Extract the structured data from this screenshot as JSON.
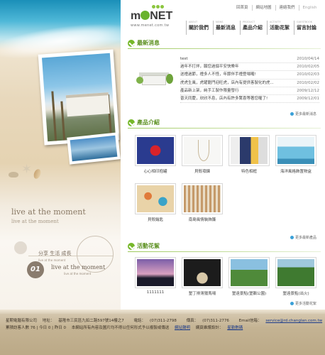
{
  "brand": {
    "name_prefix": "m",
    "name_suffix": "NET",
    "url": "www.menet.com.tw"
  },
  "top_links": [
    "回首頁",
    "網站地圖",
    "連絡我們",
    "English"
  ],
  "nav": [
    {
      "en": "About",
      "zh": "關於我們"
    },
    {
      "en": "News",
      "zh": "最新消息"
    },
    {
      "en": "Product",
      "zh": "產品介紹"
    },
    {
      "en": "Activity",
      "zh": "活動花絮"
    },
    {
      "en": "Guestbook",
      "zh": "留言討論"
    }
  ],
  "left_panel": {
    "slogan": "live at the moment",
    "slogan_small": "live at the moment",
    "tagline": "分享  生活  成長",
    "tagline_sub": "live at the moment",
    "number": "01",
    "slogan2": "live at the moment",
    "slogan2_sub": "live at the moment"
  },
  "news": {
    "title": "最新消息",
    "more": "更多最新消息",
    "items": [
      {
        "title": "test",
        "date": "2010/04/14"
      },
      {
        "title": "過年不打烊，願您過個平安快樂年",
        "date": "2010/02/05"
      },
      {
        "title": "送禮過節，禮多人不怪，年節伴手禮登場囉!",
        "date": "2010/02/03"
      },
      {
        "title": "虎虎生風，虎躍龍門迎旺虎，店內有提供客製化的虎...",
        "date": "2010/02/02"
      },
      {
        "title": "產品新上架，純手工製作限量發行",
        "date": "2009/12/12"
      },
      {
        "title": "普天同慶，欣欣不息，店內有許多驚喜等著您喔了!",
        "date": "2009/12/01"
      }
    ]
  },
  "products": {
    "title": "產品介紹",
    "more": "更多最新產品",
    "items": [
      {
        "name": "心心相印抱罐"
      },
      {
        "name": "貝殼項鍊"
      },
      {
        "name": "特色相框"
      },
      {
        "name": "海洋風格飾置物盒"
      },
      {
        "name": "貝殼鑰匙"
      },
      {
        "name": "南島風情裝飾簾"
      }
    ]
  },
  "activities": {
    "title": "活動花絮",
    "more": "更多活動花絮",
    "items": [
      {
        "name": "1111111"
      },
      {
        "name": "墾丁排灣獵馬場"
      },
      {
        "name": "墾遠景點(墾鵝公園)"
      },
      {
        "name": "墾遠景點(出火)"
      }
    ]
  },
  "footer": {
    "company": "星期電腦有限公司",
    "address_label": "地址：",
    "address": "基隆市三民區九如二路597號14樓之7",
    "phone_label": "電話：",
    "phone": "(07)311-2798",
    "fax_label": "傳真：",
    "fax": "(07)311-2776",
    "email_label": "Email信箱：",
    "email": "service@rd.changlan.com.tw",
    "visitors": "累積訪客人數 76 | 今日 0 | 昨日 0",
    "copyright": "本網站所有內容及圖片均不得以任何形式予以複製或傳送",
    "privacy": "網站聲明",
    "design_label": "網頁維護設計：",
    "design": "星勤數碼"
  },
  "colors": {
    "accent_green": "#76b82a",
    "link_blue": "#3aa0d8"
  }
}
